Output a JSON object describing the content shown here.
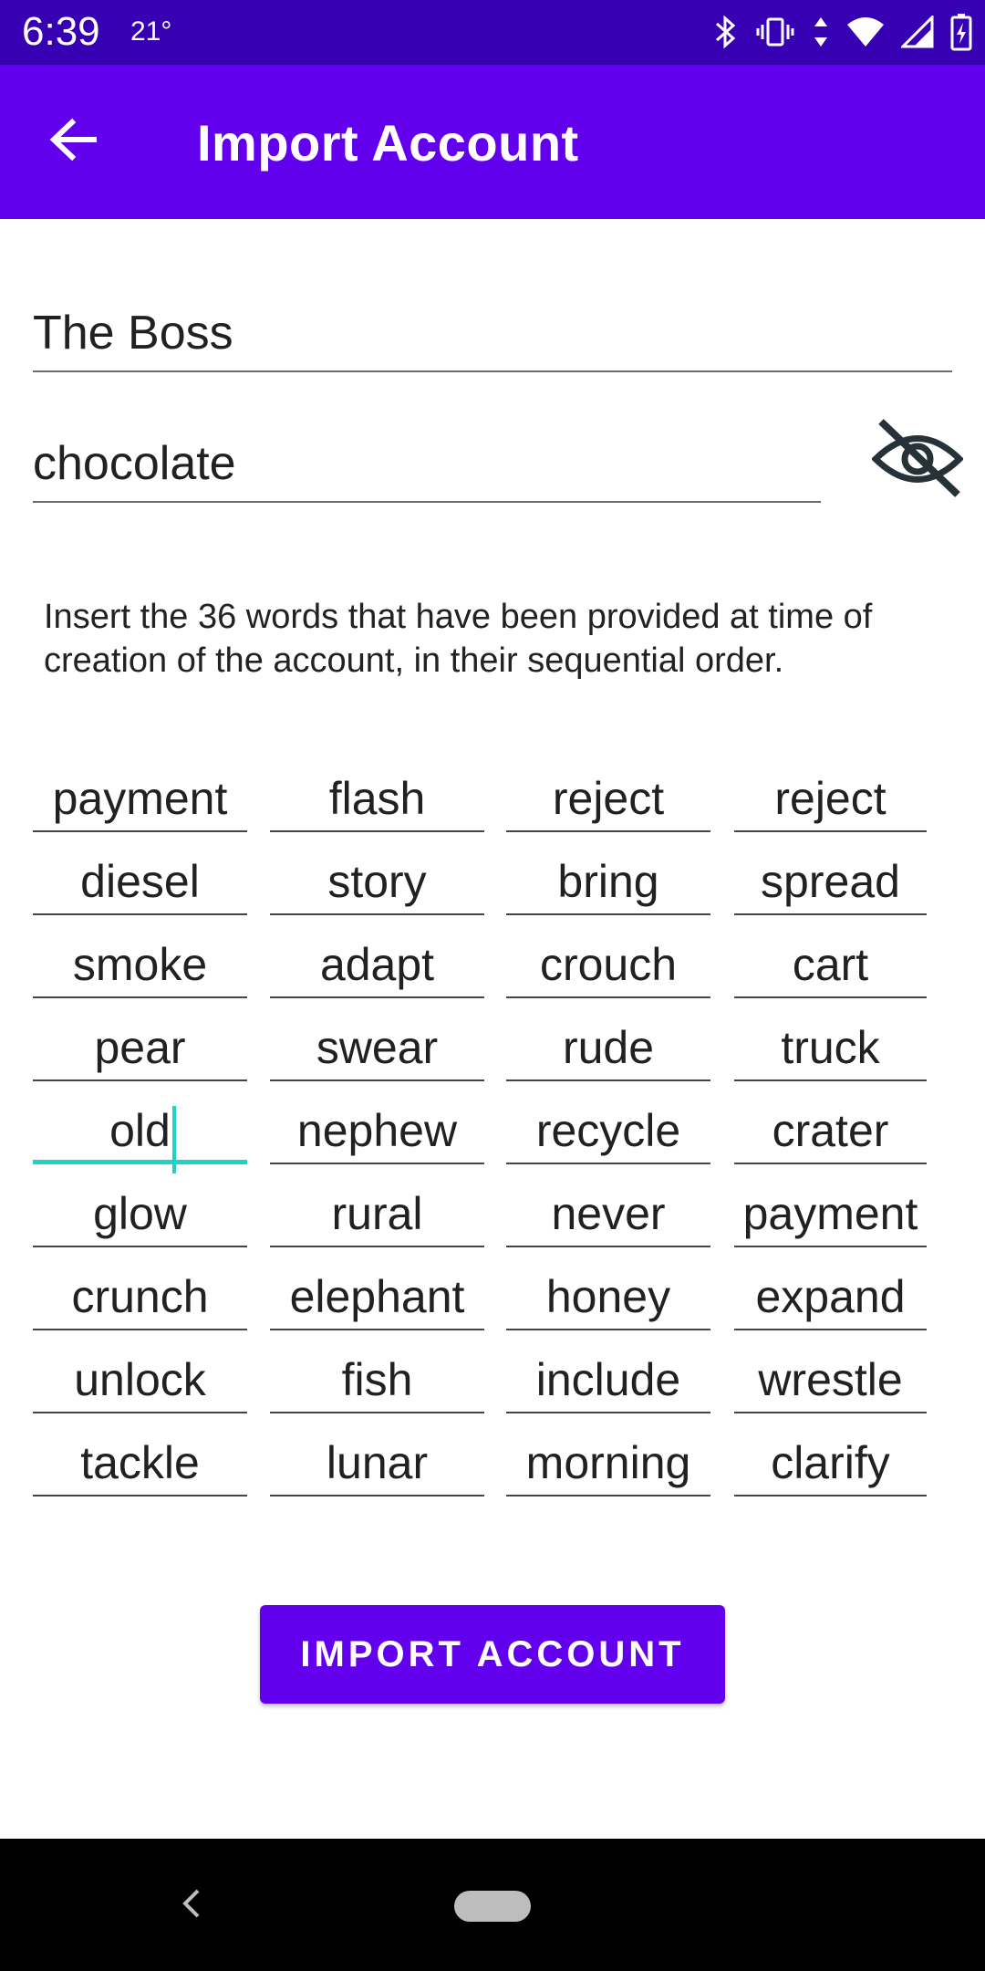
{
  "status_bar": {
    "time": "6:39",
    "temperature": "21°",
    "icons": [
      "bluetooth-icon",
      "vibrate-icon",
      "data-arrows-icon",
      "wifi-icon",
      "signal-icon",
      "battery-charging-icon"
    ]
  },
  "app_bar": {
    "title": "Import Account",
    "back_icon": "arrow-back-icon",
    "color": "#6200EE"
  },
  "form": {
    "name_value": "The Boss",
    "password_value": "chocolate",
    "visibility_icon": "eye-off-icon"
  },
  "instructions": "Insert the 36 words that have been provided at time of creation of the account, in their sequential order.",
  "words": [
    "payment",
    "flash",
    "reject",
    "reject",
    "diesel",
    "story",
    "bring",
    "spread",
    "smoke",
    "adapt",
    "crouch",
    "cart",
    "pear",
    "swear",
    "rude",
    "truck",
    "old",
    "nephew",
    "recycle",
    "crater",
    "glow",
    "rural",
    "never",
    "payment",
    "crunch",
    "elephant",
    "honey",
    "expand",
    "unlock",
    "fish",
    "include",
    "wrestle",
    "tackle",
    "lunar",
    "morning",
    "clarify"
  ],
  "active_word_index": 16,
  "import_button": {
    "label": "IMPORT ACCOUNT",
    "color": "#6200EE"
  },
  "colors": {
    "status_bar": "#3700B3",
    "accent_cursor": "#1DD4C4"
  }
}
